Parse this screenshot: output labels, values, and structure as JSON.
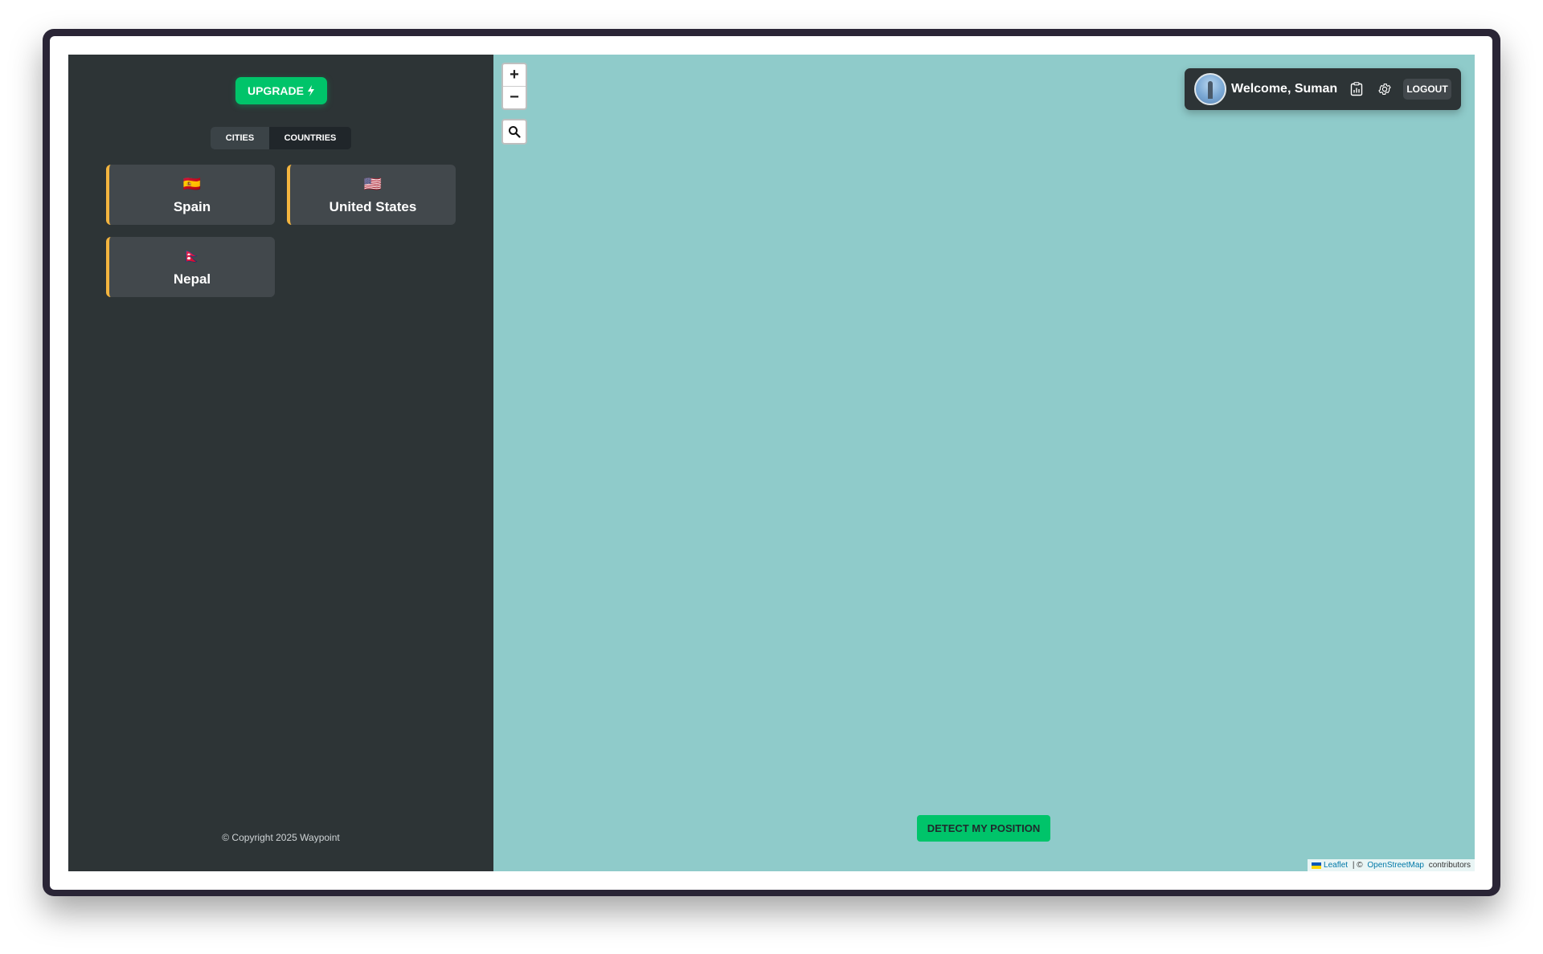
{
  "sidebar": {
    "upgrade_label": "UPGRADE",
    "tabs": [
      {
        "label": "CITIES"
      },
      {
        "label": "COUNTRIES"
      }
    ],
    "countries": [
      {
        "flag": "🇪🇸",
        "name": "Spain"
      },
      {
        "flag": "🇺🇸",
        "name": "United States"
      },
      {
        "flag": "🇳🇵",
        "name": "Nepal"
      }
    ],
    "copyright": "© Copyright 2025 Waypoint",
    "accent_color": "#f4b53f"
  },
  "map": {
    "zoom_in": "+",
    "zoom_out": "−",
    "background_color": "#8fcbca",
    "detect_label": "DETECT MY POSITION",
    "attribution": {
      "leaflet": "Leaflet",
      "separator": " | © ",
      "osm": "OpenStreetMap",
      "suffix": " contributors"
    }
  },
  "user": {
    "welcome": "Welcome, Suman",
    "logout_label": "LOGOUT"
  },
  "brand_color": "#00c46a",
  "icons": [
    "lightning-icon",
    "search-icon",
    "stats-icon",
    "gear-icon",
    "avatar"
  ]
}
